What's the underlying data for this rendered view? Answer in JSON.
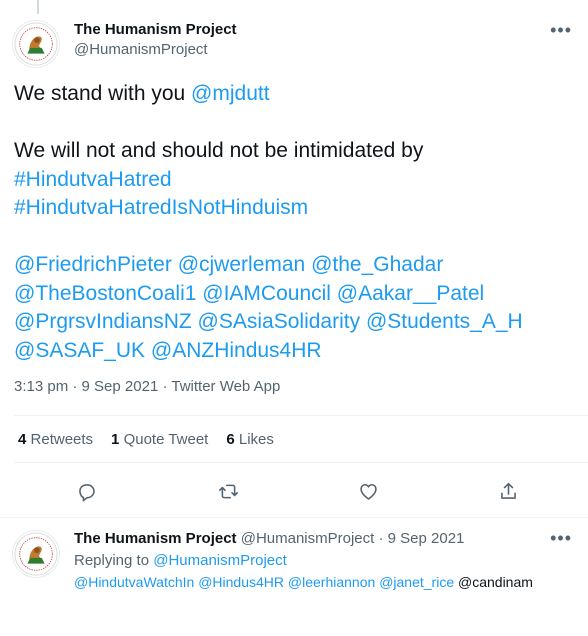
{
  "tweet": {
    "author_name": "The Humanism Project",
    "author_handle": "@HumanismProject",
    "text_intro": "We stand with you ",
    "mention_main": "@mjdutt",
    "text_line2": "We will not and should not be intimidated by",
    "hashtag1": "#HindutvaHatred",
    "hashtag2": "#HindutvaHatredIsNotHinduism",
    "mentions": [
      [
        "@FriedrichPieter",
        "@cjwerleman",
        "@the_Ghadar"
      ],
      [
        "@TheBostonCoali1",
        "@IAMCouncil",
        "@Aakar__Patel"
      ],
      [
        "@PrgrsvIndiansNZ",
        "@SAsiaSolidarity",
        "@Students_A_H"
      ],
      [
        "@SASAF_UK",
        "@ANZHindus4HR"
      ]
    ],
    "time": "3:13 pm",
    "date": "9 Sep 2021",
    "source": "Twitter Web App",
    "stats": {
      "retweets_count": "4",
      "retweets_label": "Retweets",
      "quotes_count": "1",
      "quotes_label": "Quote Tweet",
      "likes_count": "6",
      "likes_label": "Likes"
    }
  },
  "reply": {
    "author_name": "The Humanism Project",
    "author_handle": "@HumanismProject",
    "date": "9 Sep 2021",
    "replying_label": "Replying to",
    "replying_handle": "@HumanismProject",
    "mentions": [
      "@HindutvaWatchIn",
      "@Hindus4HR",
      "@leerhiannon",
      "@janet_rice"
    ],
    "trailing": "@candinam"
  },
  "icons": {
    "reply": "reply-icon",
    "retweet": "retweet-icon",
    "like": "heart-icon",
    "share": "share-icon",
    "more": "more-icon"
  },
  "colors": {
    "link": "#1d9bf0",
    "secondary_text": "#536471",
    "primary_text": "#0f1419",
    "divider": "#eff3f4"
  }
}
